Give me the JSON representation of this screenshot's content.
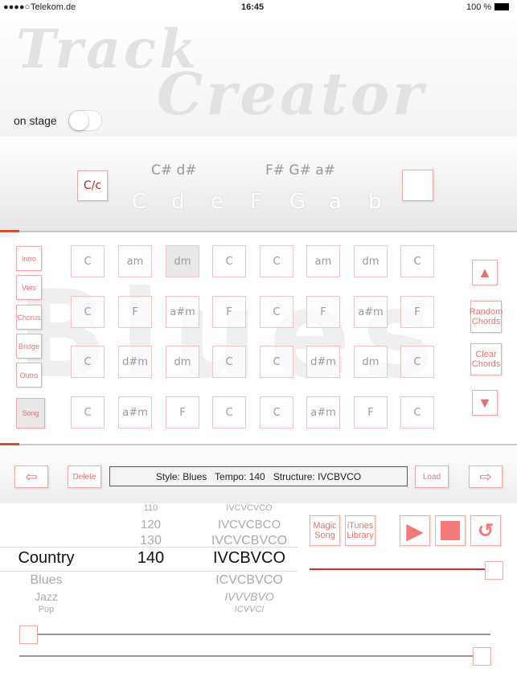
{
  "status": {
    "carrier": "Telekom.de",
    "time": "16:45",
    "battery": "100 %"
  },
  "header": {
    "logo_line1": "Track",
    "logo_line2": "Creator",
    "on_stage_label": "on stage",
    "on_stage_on": false
  },
  "keys": {
    "mode_button": "C/c",
    "sharps_left": "C# d#",
    "sharps_right": "F# G# a#",
    "naturals": [
      "C",
      "d",
      "e",
      "F",
      "G",
      "a",
      "b"
    ]
  },
  "grid": {
    "watermark": "Blues",
    "sections": [
      "Intro",
      "Vers",
      "Chorus",
      "Bridge",
      "Outro",
      "Song"
    ],
    "selected_section": "Song",
    "rows": [
      [
        "C",
        "am",
        "dm",
        "C",
        "C",
        "am",
        "dm",
        "C"
      ],
      [
        "C",
        "F",
        "a#m",
        "F",
        "C",
        "F",
        "a#m",
        "F"
      ],
      [
        "C",
        "d#m",
        "dm",
        "C",
        "C",
        "d#m",
        "dm",
        "C"
      ],
      [
        "C",
        "a#m",
        "F",
        "C",
        "C",
        "a#m",
        "F",
        "C"
      ]
    ],
    "selected_cell": [
      0,
      2
    ],
    "random_chords": "Random Chords",
    "clear_chords": "Clear Chords"
  },
  "toolbar": {
    "delete": "Delete",
    "info": "Style: Blues   Tempo: 140   Structure: IVCBVCO",
    "load": "Load"
  },
  "picker": {
    "styles": [
      "",
      "",
      "",
      "Country",
      "Blues",
      "Jazz",
      "Pop"
    ],
    "tempos": [
      "110",
      "120",
      "130",
      "140",
      "",
      "",
      ""
    ],
    "structures": [
      "IVCVCVCO",
      "IVCVCBCO",
      "IVCVCBVCO",
      "IVCBVCO",
      "ICVCBVCO",
      "IVVVBVO",
      "ICVVCI"
    ],
    "selected_index": 3
  },
  "controls": {
    "magic_song": "Magic Song",
    "itunes_library": "iTunes Library",
    "volume": 1.0,
    "slider1": 0.0,
    "slider2": 1.0
  },
  "colors": {
    "accent": "#f08080",
    "accent_dark": "#d03030"
  }
}
